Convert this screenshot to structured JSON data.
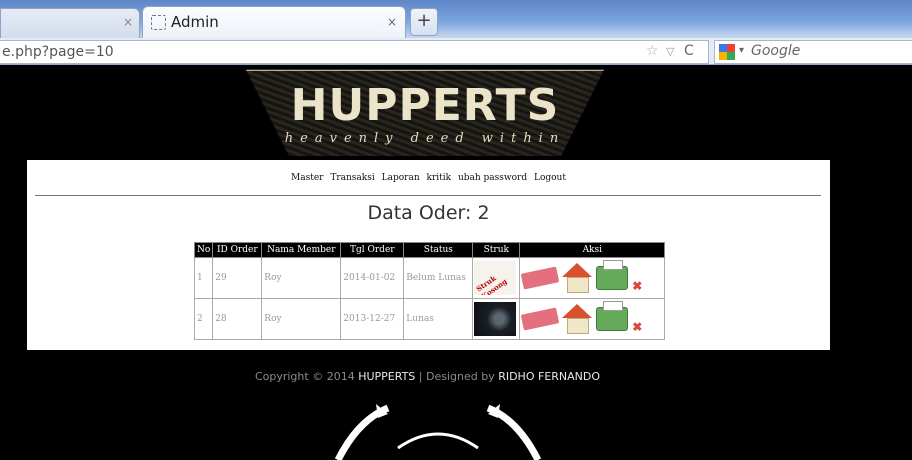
{
  "browser": {
    "prev_tab_close": "×",
    "active_tab_title": "Admin",
    "active_tab_close": "×",
    "new_tab": "+",
    "url": "e.php?page=10",
    "search_placeholder": "Google"
  },
  "banner": {
    "logo": "HUPPERTS",
    "tagline": "heavenly deed within"
  },
  "nav": [
    "Master",
    "Transaksi",
    "Laporan",
    "kritik",
    "ubah password",
    "Logout"
  ],
  "page_title": "Data Oder: 2",
  "table": {
    "headers": [
      "No",
      "ID Order",
      "Nama Member",
      "Tgl Order",
      "Status",
      "Struk",
      "Aksi"
    ],
    "rows": [
      {
        "no": "1",
        "id": "29",
        "member": "Roy",
        "date": "2014-01-02",
        "status": "Belum Lunas",
        "struk_text": "Struk Kosong"
      },
      {
        "no": "2",
        "id": "28",
        "member": "Roy",
        "date": "2013-12-27",
        "status": "Lunas",
        "struk_text": ""
      }
    ],
    "delete_glyph": "✖"
  },
  "footer": {
    "prefix": "Copyright © 2014 ",
    "brand": "HUPPERTS",
    "middle": " | Designed by ",
    "designer": "RIDHO FERNANDO"
  },
  "colors": {
    "background": "#000000",
    "panel": "#ffffff",
    "table_header": "#000000"
  }
}
